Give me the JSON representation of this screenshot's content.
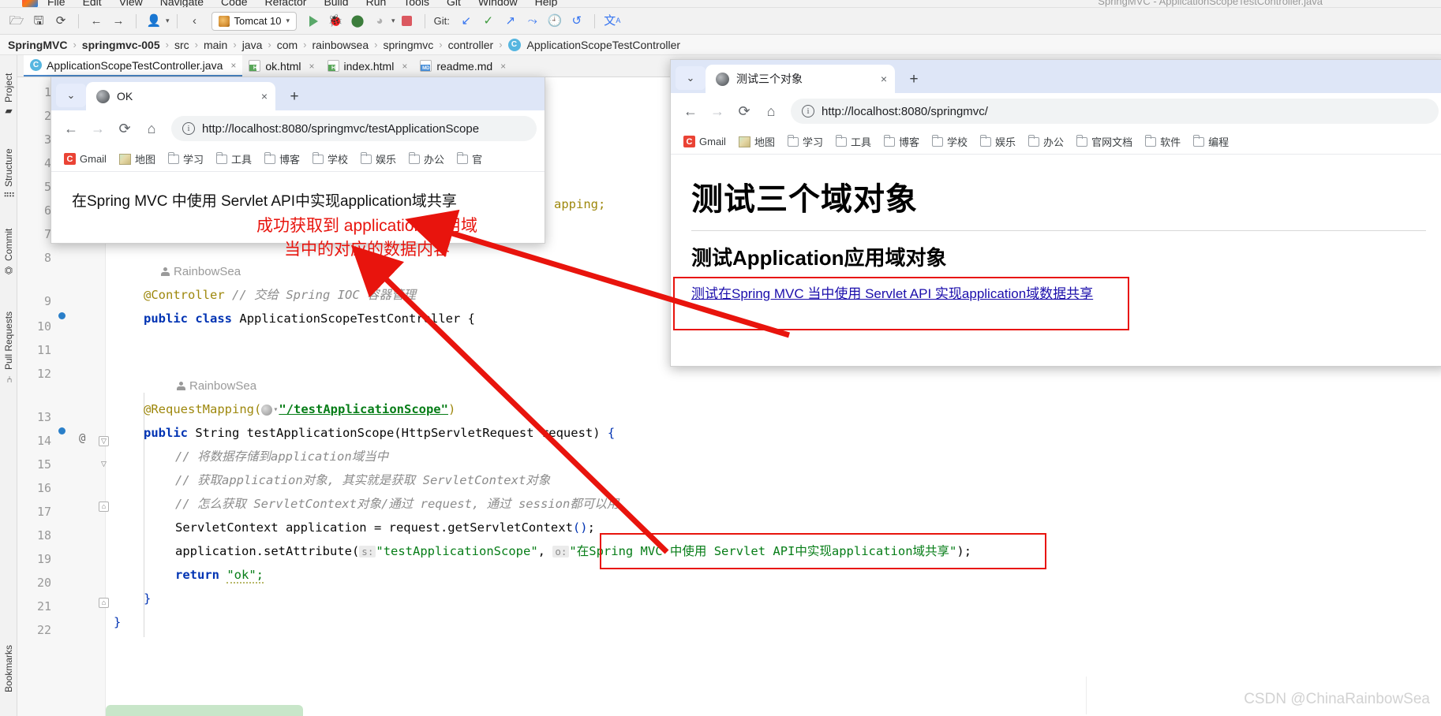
{
  "ide": {
    "window_title": "SpringMVC - ApplicationScopeTestController.java",
    "menu": [
      "File",
      "Edit",
      "View",
      "Navigate",
      "Code",
      "Refactor",
      "Build",
      "Run",
      "Tools",
      "Git",
      "Window",
      "Help"
    ],
    "toolbar": {
      "open_label": "open-project",
      "save_label": "save-all",
      "sync_label": "sync",
      "back_label": "back",
      "forward_label": "forward",
      "profile_label": "profiler",
      "updown_label": "navigate-up",
      "run_config": "Tomcat 10",
      "run_label": "Run",
      "debug_label": "Debug",
      "rerun_label": "Run with coverage",
      "profile2_label": "Profile",
      "stop_label": "Stop",
      "git_label": "Git:",
      "git_update": "update-project",
      "git_commit": "commit",
      "git_push": "push",
      "git_rebase": "rebase",
      "git_history": "history",
      "git_rollback": "rollback",
      "translate_label": "translate"
    },
    "breadcrumb": [
      "SpringMVC",
      "springmvc-005",
      "src",
      "main",
      "java",
      "com",
      "rainbowsea",
      "springmvc",
      "controller",
      "ApplicationScopeTestController"
    ],
    "editor_tabs": [
      {
        "label": "ApplicationScopeTestController.java",
        "type": "java",
        "badge": "C",
        "active": true
      },
      {
        "label": "ok.html",
        "type": "html",
        "badge": "H",
        "active": false
      },
      {
        "label": "index.html",
        "type": "html",
        "badge": "H",
        "active": false
      },
      {
        "label": "readme.md",
        "type": "md",
        "badge": "MD",
        "active": false
      }
    ],
    "left_strip": [
      "Project",
      "Structure",
      "Commit",
      "Pull Requests",
      "Bookmarks"
    ],
    "line_numbers": [
      "1",
      "2",
      "3",
      "4",
      "5",
      "6",
      "7",
      "8",
      "9",
      "10",
      "11",
      "12",
      "13",
      "14",
      "15",
      "16",
      "17",
      "18",
      "19",
      "20",
      "21",
      "22"
    ],
    "code": {
      "line6_tail": "apping;",
      "vcs_author_1": "RainbowSea",
      "line9_ann": "@Controller",
      "line9_comment": "// 交给 Spring IOC 容器管理",
      "line10_kw1": "public",
      "line10_kw2": "class",
      "line10_name": "ApplicationScopeTestController {",
      "vcs_author_2": "RainbowSea",
      "line13_ann": "@RequestMapping(",
      "line13_path": "\"/testApplicationScope\"",
      "line13_close": ")",
      "line14": "public String testApplicationScope(HttpServletRequest request) {",
      "line15_comment": "// 将数据存储到application域当中",
      "line16_comment": "// 获取application对象, 其实就是获取 ServletContext对象",
      "line17_comment": "// 怎么获取 ServletContext对象/通过 request, 通过 session都可以用",
      "line18": "ServletContext application = request.getServletContext();",
      "line19_pre": "application.setAttribute(",
      "line19_hint_s": "s:",
      "line19_arg1": "\"testApplicationScope\"",
      "line19_hint_o": "o:",
      "line19_arg2": "\"在Spring MVC 中使用 Servlet API中实现application域共享\"",
      "line19_post": ");",
      "line20_kw": "return",
      "line20_str": "\"ok\";",
      "line21": "}"
    }
  },
  "browser_ok": {
    "tab_title": "OK",
    "url": "http://localhost:8080/springmvc/testApplicationScope",
    "new_tab_label": "+",
    "close_label": "×",
    "nav": {
      "back": "←",
      "forward": "→",
      "reload": "⟳",
      "home": "⌂",
      "info": "i"
    },
    "bookmarks": [
      {
        "label": "Gmail",
        "icon": "gmail-icon"
      },
      {
        "label": "地图",
        "icon": "map-icon"
      },
      {
        "label": "学习",
        "icon": "folder-icon"
      },
      {
        "label": "工具",
        "icon": "folder-icon"
      },
      {
        "label": "博客",
        "icon": "folder-icon"
      },
      {
        "label": "学校",
        "icon": "folder-icon"
      },
      {
        "label": "娱乐",
        "icon": "folder-icon"
      },
      {
        "label": "办公",
        "icon": "folder-icon"
      },
      {
        "label": "官",
        "icon": "folder-icon"
      }
    ],
    "body_text": "在Spring MVC 中使用 Servlet API中实现application域共享"
  },
  "browser_index": {
    "tab_title": "测试三个对象",
    "url": "http://localhost:8080/springmvc/",
    "new_tab_label": "+",
    "close_label": "×",
    "nav": {
      "back": "←",
      "forward": "→",
      "reload": "⟳",
      "home": "⌂",
      "info": "i"
    },
    "bookmarks": [
      {
        "label": "Gmail",
        "icon": "gmail-icon"
      },
      {
        "label": "地图",
        "icon": "map-icon"
      },
      {
        "label": "学习",
        "icon": "folder-icon"
      },
      {
        "label": "工具",
        "icon": "folder-icon"
      },
      {
        "label": "博客",
        "icon": "folder-icon"
      },
      {
        "label": "学校",
        "icon": "folder-icon"
      },
      {
        "label": "娱乐",
        "icon": "folder-icon"
      },
      {
        "label": "办公",
        "icon": "folder-icon"
      },
      {
        "label": "官网文档",
        "icon": "folder-icon"
      },
      {
        "label": "软件",
        "icon": "folder-icon"
      },
      {
        "label": "编程",
        "icon": "folder-icon"
      }
    ],
    "h1": "测试三个域对象",
    "h2": "测试Application应用域对象",
    "link": "测试在Spring MVC 当中使用 Servlet API 实现application域数据共享"
  },
  "annotations": {
    "note1": "成功获取到 application 应用域\n当中的对应的数据内容",
    "accent_color": "#e8140d"
  },
  "watermark": "CSDN @ChinaRainbowSea"
}
